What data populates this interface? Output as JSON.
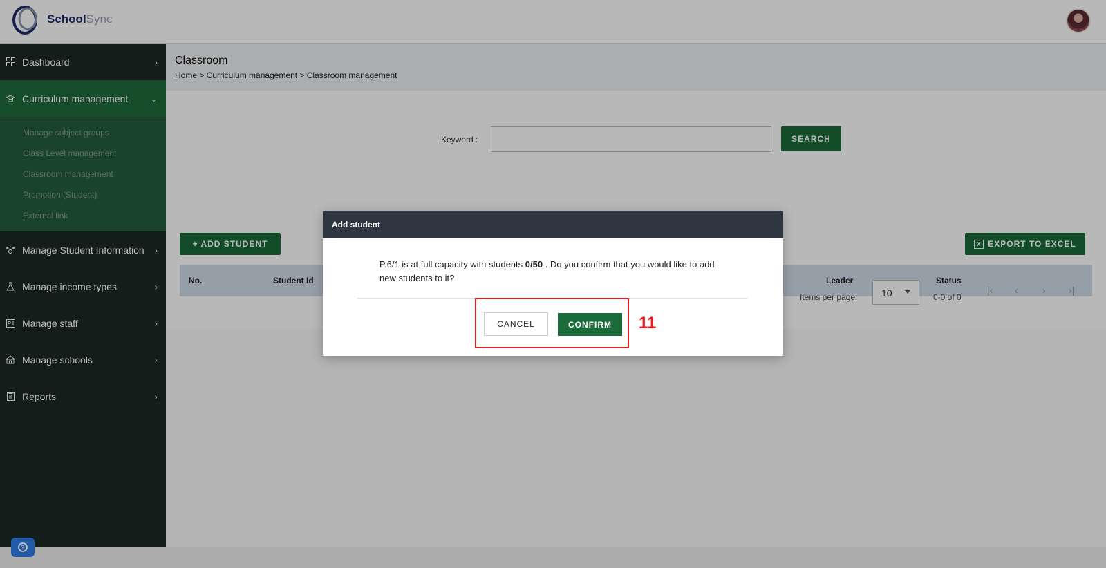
{
  "brand": {
    "name_bold": "School",
    "name_light": "Sync"
  },
  "colors": {
    "primary_green": "#1a6a3a",
    "sidebar_bg": "#1b2a26",
    "annotation_red": "#e41e1e",
    "modal_header": "#2f3541"
  },
  "sidebar": {
    "items": [
      {
        "label": "Dashboard",
        "icon": "grid-icon"
      },
      {
        "label": "Curriculum management",
        "icon": "graduation-cap-icon",
        "active": true
      },
      {
        "label": "Manage Student Information",
        "icon": "student-icon"
      },
      {
        "label": "Manage income types",
        "icon": "flask-icon"
      },
      {
        "label": "Manage staff",
        "icon": "id-card-icon"
      },
      {
        "label": "Manage schools",
        "icon": "school-icon"
      },
      {
        "label": "Reports",
        "icon": "clipboard-icon"
      }
    ],
    "submenu": [
      "Manage subject groups",
      "Class Level management",
      "Classroom management",
      "Promotion (Student)",
      "External link"
    ]
  },
  "page": {
    "title": "Classroom",
    "breadcrumb": "Home > Curriculum management > Classroom management"
  },
  "search": {
    "label": "Keyword :",
    "value": "",
    "button": "SEARCH"
  },
  "actions": {
    "add_student": "+ ADD STUDENT",
    "export": "EXPORT TO EXCEL"
  },
  "table": {
    "columns": [
      "No.",
      "Student Id",
      "Leader",
      "Status"
    ]
  },
  "pagination": {
    "items_per_page_label": "Items per page:",
    "items_per_page": "10",
    "range": "0-0 of 0"
  },
  "modal": {
    "title": "Add student",
    "message_prefix": "P.6/1 is at full capacity with students ",
    "capacity": "0/50",
    "message_suffix": " . Do you confirm that you would like to add new students to it?",
    "cancel": "CANCEL",
    "confirm": "CONFIRM"
  },
  "annotation": {
    "step": "11"
  }
}
